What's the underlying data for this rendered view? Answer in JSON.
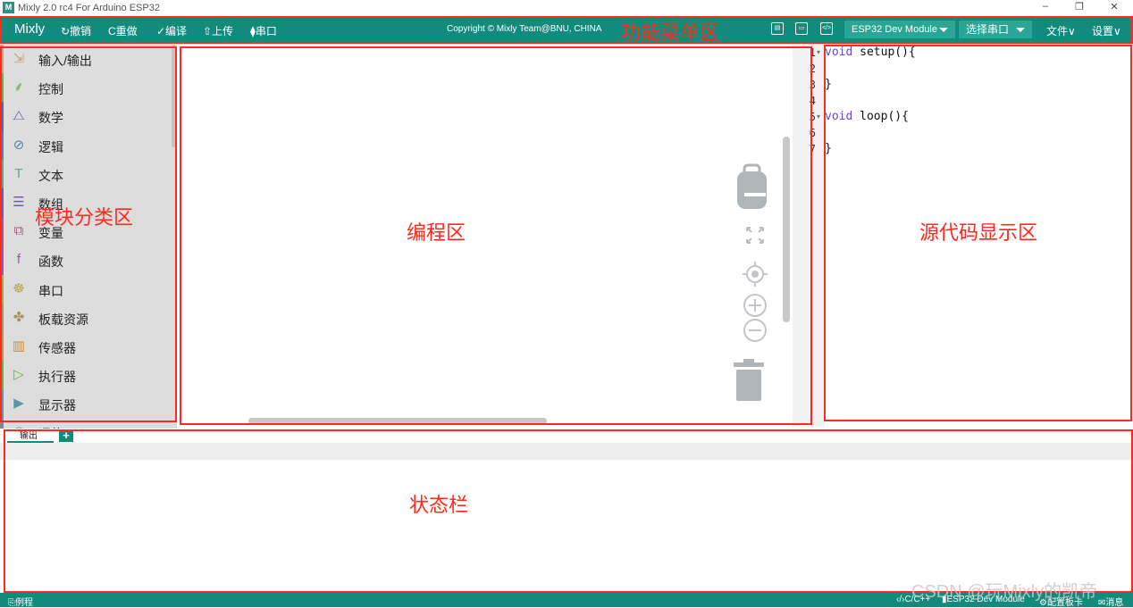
{
  "window": {
    "title": "Mixly 2.0 rc4 For Arduino ESP32",
    "logo_text": "M"
  },
  "menubar": {
    "brand": "Mixly",
    "undo": "↻撤销",
    "redo": "C重做",
    "compile": "✓编译",
    "upload": "⇧上传",
    "serial": "⧫串口",
    "copyright": "Copyright © Mixly Team@BNU, CHINA",
    "board": "ESP32 Dev Module",
    "port": "选择串口",
    "file": "文件∨",
    "settings": "设置∨"
  },
  "toolbox": {
    "categories": [
      {
        "label": "输入/输出",
        "icon": "⇲",
        "color": "#c9a27a"
      },
      {
        "label": "控制",
        "icon": "⸙",
        "color": "#66b04a"
      },
      {
        "label": "数学",
        "icon": "⧍",
        "color": "#5b67a5"
      },
      {
        "label": "逻辑",
        "icon": "⊘",
        "color": "#5b80a5"
      },
      {
        "label": "文本",
        "icon": "T",
        "color": "#5ba58c"
      },
      {
        "label": "数组",
        "icon": "☰",
        "color": "#745ba5"
      },
      {
        "label": "变量",
        "icon": "⧉",
        "color": "#a55b80"
      },
      {
        "label": "函数",
        "icon": "f",
        "color": "#995ba5"
      },
      {
        "label": "串口",
        "icon": "☸",
        "color": "#b8a14d"
      },
      {
        "label": "板载资源",
        "icon": "✤",
        "color": "#a5945b"
      },
      {
        "label": "传感器",
        "icon": "▥",
        "color": "#c28e4d"
      },
      {
        "label": "执行器",
        "icon": "▷",
        "color": "#66b04a"
      },
      {
        "label": "显示器",
        "icon": "▶",
        "color": "#5b99a5"
      },
      {
        "label": "通信",
        "icon": "◎",
        "color": "#888888"
      }
    ]
  },
  "editor": {
    "line_numbers": [
      "1",
      "2",
      "3",
      "4",
      "5",
      "6",
      "7"
    ],
    "kw_void": "void",
    "line1_rest": " setup(){",
    "line3": "}",
    "line5_rest": " loop(){",
    "line7": "}"
  },
  "output": {
    "tab_label": "输出",
    "add_label": "+"
  },
  "statusbar": {
    "examples": "⎘例程",
    "language": "‹/›C/C++",
    "board": "ESP32 Dev Module",
    "config": "⚙配置板卡",
    "messages": "✉消息"
  },
  "annotations": {
    "menu_area": "功能菜单区",
    "block_category_area": "模块分类区",
    "programming_area": "编程区",
    "source_code_area": "源代码显示区",
    "status_area": "状态栏"
  },
  "watermark": "CSDN @玩Mixly的凯帝",
  "colors": {
    "accent": "#138b7c",
    "annotation": "#ff2a1f"
  }
}
